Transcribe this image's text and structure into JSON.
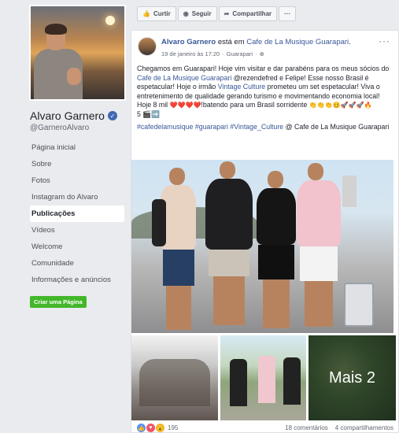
{
  "sidebar": {
    "page_name": "Alvaro Garnero",
    "page_handle": "@GarneroAlvaro",
    "nav_items": [
      {
        "label": "Página inicial"
      },
      {
        "label": "Sobre"
      },
      {
        "label": "Fotos"
      },
      {
        "label": "Instagram do Alvaro"
      },
      {
        "label": "Publicações",
        "active": true
      },
      {
        "label": "Vídeos"
      },
      {
        "label": "Welcome"
      },
      {
        "label": "Comunidade"
      },
      {
        "label": "Informações e anúncios"
      }
    ],
    "create_page_label": "Criar uma Página"
  },
  "actionbar": {
    "like_label": "Curtir",
    "follow_label": "Seguir",
    "share_label": "Compartilhar",
    "more_label": "···"
  },
  "post": {
    "author": "Alvaro Garnero",
    "at_text": "está em",
    "place": "Cafe de La Musique Guarapari",
    "date": "19 de janeiro às 17:20",
    "location": "Guarapari",
    "text_1": "Chegamos em Guarapari! Hoje vim visitar e dar parabéns para os meus sócios do ",
    "text_link_1": "Cafe de La Musique Guarapari",
    "text_2": " @rezendefred e Felipe! Esse nosso Brasil é espetacular! Hoje o irmão ",
    "text_link_2": "Vintage Culture",
    "text_3": " prometeu um set espetacular! Viva o entretenimento de qualidade gerando turismo e movimentando economia local! Hoje 8 mil ",
    "emoji_hearts": "❤️❤️❤️❤️",
    "text_4": "!batendo para um Brasil sorridente ",
    "emoji_row": "👏👏👏🥴🚀🚀🚀🔥",
    "text_5": "5 🎬➡️",
    "hashtags": [
      "#cafedelamusique",
      "#guarapari",
      "#Vintage_Culture"
    ],
    "at_place_label": "@ Cafe de La Musique Guarapari",
    "more_photos_label": "Mais 2",
    "reactions_count": "195",
    "comments_count": "18 comentários",
    "shares_count": "4 compartilhamentos"
  },
  "colors": {
    "link": "#385898",
    "verified": "#4267b2",
    "green": "#42b72a"
  }
}
